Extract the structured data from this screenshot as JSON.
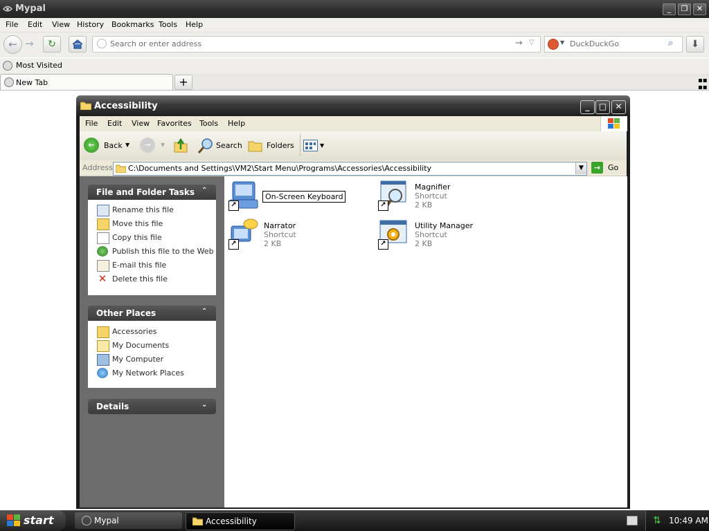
{
  "browser": {
    "title": "Mypal",
    "menu": [
      "File",
      "Edit",
      "View",
      "History",
      "Bookmarks",
      "Tools",
      "Help"
    ],
    "url_placeholder": "Search or enter address",
    "search_engine": "DuckDuckGo",
    "bookmarks": [
      {
        "label": "Most Visited"
      }
    ],
    "tabs": [
      {
        "label": "New Tab"
      }
    ]
  },
  "explorer": {
    "title": "Accessibility",
    "menu": [
      "File",
      "Edit",
      "View",
      "Favorites",
      "Tools",
      "Help"
    ],
    "toolbar": {
      "back": "Back",
      "search": "Search",
      "folders": "Folders"
    },
    "address_label": "Address",
    "address": "C:\\Documents and Settings\\VM2\\Start Menu\\Programs\\Accessories\\Accessibility",
    "go": "Go",
    "file_tasks": {
      "title": "File and Folder Tasks",
      "items": [
        "Rename this file",
        "Move this file",
        "Copy this file",
        "Publish this file to the Web",
        "E-mail this file",
        "Delete this file"
      ]
    },
    "other_places": {
      "title": "Other Places",
      "items": [
        "Accessories",
        "My Documents",
        "My Computer",
        "My Network Places"
      ]
    },
    "details": {
      "title": "Details"
    },
    "files": [
      {
        "name": "On-Screen Keyboard",
        "type": "",
        "size": "",
        "renaming": true,
        "icon": "keyboard-icon"
      },
      {
        "name": "Magnifier",
        "type": "Shortcut",
        "size": "2 KB",
        "icon": "magnifier-icon"
      },
      {
        "name": "Narrator",
        "type": "Shortcut",
        "size": "2 KB",
        "icon": "narrator-icon"
      },
      {
        "name": "Utility Manager",
        "type": "Shortcut",
        "size": "2 KB",
        "icon": "utility-manager-icon"
      }
    ]
  },
  "taskbar": {
    "start": "start",
    "tasks": [
      {
        "label": "Mypal"
      },
      {
        "label": "Accessibility",
        "active": true
      }
    ],
    "clock": "10:49 AM"
  },
  "colors": {
    "panel_header": "#4a4a4a",
    "left_pane": "#6c6c6c",
    "address_border": "#7f9db9",
    "selection": "#c0c0c0"
  }
}
